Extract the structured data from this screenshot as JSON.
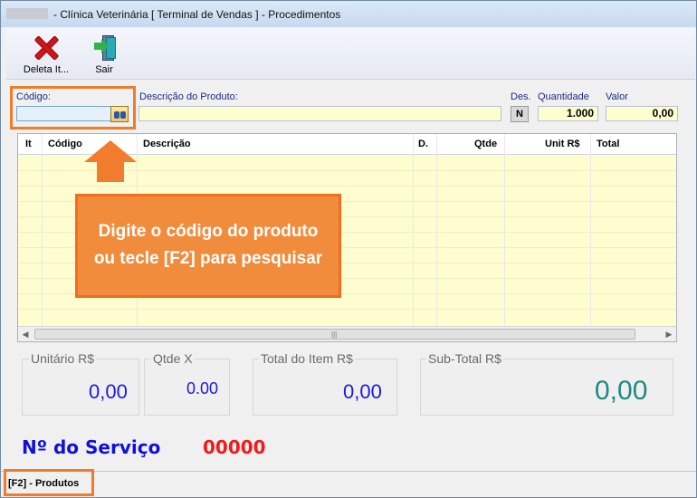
{
  "window": {
    "title": "- Clínica Veterinária [ Terminal de Vendas ] - Procedimentos"
  },
  "toolbar": {
    "delete_label": "Deleta It...",
    "exit_label": "Sair"
  },
  "fields": {
    "codigo_label": "Código:",
    "descricao_label": "Descrição do  Produto:",
    "des_label": "Des.",
    "des_button": "N",
    "quantidade_label": "Quantidade",
    "quantidade_value": "1.000",
    "valor_label": "Valor",
    "valor_value": "0,00"
  },
  "grid": {
    "columns": [
      "It",
      "Código",
      "Descrição",
      "D.",
      "Qtde",
      "Unit R$",
      "Total"
    ],
    "rows": []
  },
  "hint": {
    "line1": "Digite o código do produto",
    "line2": "ou tecle [F2] para pesquisar"
  },
  "summary": {
    "unitario_label": "Unitário R$",
    "unitario_value": "0,00",
    "qtde_label": "Qtde X",
    "qtde_value": "0.00",
    "total_item_label": "Total do Item R$",
    "total_item_value": "0,00",
    "subtotal_label": "Sub-Total R$",
    "subtotal_value": "0,00"
  },
  "servico": {
    "label": "Nº do Serviço",
    "number": "00000"
  },
  "statusbar": {
    "text": "[F2] - Produtos"
  },
  "colors": {
    "accent_orange": "#f07b2b",
    "blue_value": "#1a1adf",
    "teal_value": "#1f8a82",
    "red_number": "#ee1c1c",
    "grid_yellow": "#fdfdcf"
  },
  "icons": {
    "delete": "delete-x-icon",
    "exit": "exit-door-icon",
    "search": "binoculars-icon"
  }
}
